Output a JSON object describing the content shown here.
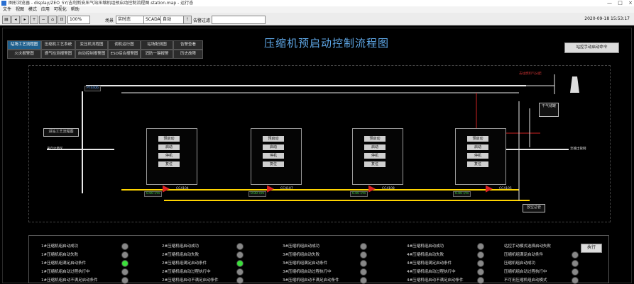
{
  "window": {
    "title": "图形浏览器 - display/ZEO_5Y/吉利新安压气站压缩机组预启动控制流程图.station.map - 运行态",
    "controls": [
      "—",
      "□",
      "×"
    ]
  },
  "menu": [
    "文件",
    "视图",
    "模式",
    "应用",
    "可视化",
    "帮助"
  ],
  "toolbar": {
    "zoom": "100%",
    "scene_label": "场景",
    "scene_value": "实时态",
    "scada_label": "SCADA",
    "auto_value": "自动",
    "alarm_label": "告警过滤",
    "datetime": "2020-09-18 15:53:17"
  },
  "nav": {
    "row1": [
      "站场工艺流程图",
      "压缩机工艺系统",
      "变压机流程图",
      "调机运行图",
      "站场配测图",
      "告警查看"
    ],
    "row2": [
      "火灾报警图",
      "燃气检测报警图",
      "自动控制报警图",
      "ESD综合报警图",
      "消防一键报警",
      "历史故障"
    ]
  },
  "page_title": "压缩机预启动控制流程图",
  "launch_button": "站控手动启动命令",
  "diagram": {
    "left_out": "进站工艺流程图",
    "left_label": "来自计量区",
    "right_label": "至输出管网",
    "top_tag": "去往燃料气分配",
    "air_tank": "干气储罐",
    "bottom_box": "放空总管",
    "left_tag": "PT4406",
    "units": [
      {
        "name": "CC4104",
        "buttons": [
          "预启动",
          "启动",
          "停机",
          "复位"
        ],
        "speed": "0.00 r/m"
      },
      {
        "name": "CC4107",
        "buttons": [
          "预启动",
          "启动",
          "停机",
          "复位"
        ],
        "speed": "0.00 r/m"
      },
      {
        "name": "CC4108",
        "buttons": [
          "预启动",
          "启动",
          "停机",
          "复位"
        ],
        "speed": "0.00 r/m"
      },
      {
        "name": "CC4105",
        "buttons": [
          "预启动",
          "启动",
          "停机",
          "复位"
        ],
        "speed": "0.00 r/m"
      }
    ]
  },
  "status": {
    "columns": [
      {
        "rows": [
          {
            "label": "1#压缩机组启动成功",
            "on": false
          },
          {
            "label": "1#压缩机组启动失败",
            "on": false
          },
          {
            "label": "1#压缩机组满足启动条件",
            "on": true
          },
          {
            "label": "1#压缩机组启动过程执行中",
            "on": false
          },
          {
            "label": "1#压缩机组启动不满足启动条件",
            "on": false
          }
        ]
      },
      {
        "rows": [
          {
            "label": "2#压缩机组启动成功",
            "on": false
          },
          {
            "label": "2#压缩机组启动失败",
            "on": false
          },
          {
            "label": "2#压缩机组满足启动条件",
            "on": true
          },
          {
            "label": "2#压缩机组启动过程执行中",
            "on": false
          },
          {
            "label": "2#压缩机组启动不满足启动条件",
            "on": false
          }
        ]
      },
      {
        "rows": [
          {
            "label": "3#压缩机组启动成功",
            "on": false
          },
          {
            "label": "3#压缩机组启动失败",
            "on": false
          },
          {
            "label": "3#压缩机组满足启动条件",
            "on": false
          },
          {
            "label": "3#压缩机组启动过程执行中",
            "on": false
          },
          {
            "label": "3#压缩机组启动不满足启动条件",
            "on": false
          }
        ]
      },
      {
        "rows": [
          {
            "label": "4#压缩机组启动成功",
            "on": false
          },
          {
            "label": "4#压缩机组启动失败",
            "on": false
          },
          {
            "label": "4#压缩机组满足启动条件",
            "on": false
          },
          {
            "label": "4#压缩机组启动过程执行中",
            "on": false
          },
          {
            "label": "4#压缩机组启动不满足启动条件",
            "on": false
          }
        ]
      },
      {
        "rows": [
          {
            "label": "站控手动模式选择启动失败",
            "on": false
          },
          {
            "label": "压缩机组满足启动条件",
            "on": false
          },
          {
            "label": "压缩机组启动成功",
            "on": false
          },
          {
            "label": "压缩机组启动过程执行中",
            "on": false
          },
          {
            "label": "不可用压缩机组启动模式",
            "on": false
          }
        ]
      }
    ],
    "exec_label": "执行"
  }
}
